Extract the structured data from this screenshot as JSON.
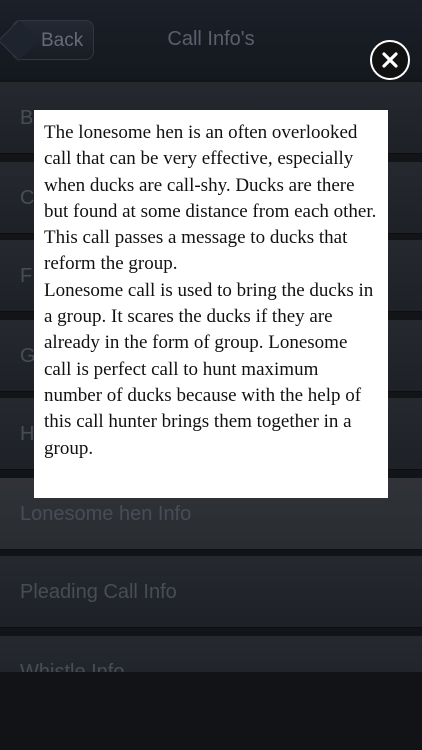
{
  "nav": {
    "back_label": "Back",
    "title": "Call Info's"
  },
  "list": {
    "items": [
      {
        "label": "B"
      },
      {
        "label": "C"
      },
      {
        "label": "F"
      },
      {
        "label": "G"
      },
      {
        "label": "H"
      },
      {
        "label": "Lonesome hen Info"
      },
      {
        "label": "Pleading Call Info"
      },
      {
        "label": "Whistle Info"
      }
    ]
  },
  "popup": {
    "paragraph_1": "The lonesome hen is an often overlooked call that can be very effective, especially when ducks are call-shy. Ducks are there but found at some distance from each other. This call passes a message to ducks that reform the group.",
    "paragraph_2": "Lonesome call is used to bring the ducks in a group. It scares the ducks if they are already in the form of group. Lonesome call is perfect call to hunt maximum number of ducks because with the help of this call hunter brings them together in a group."
  },
  "icons": {
    "close": "close-icon",
    "back": "chevron-left-icon"
  }
}
